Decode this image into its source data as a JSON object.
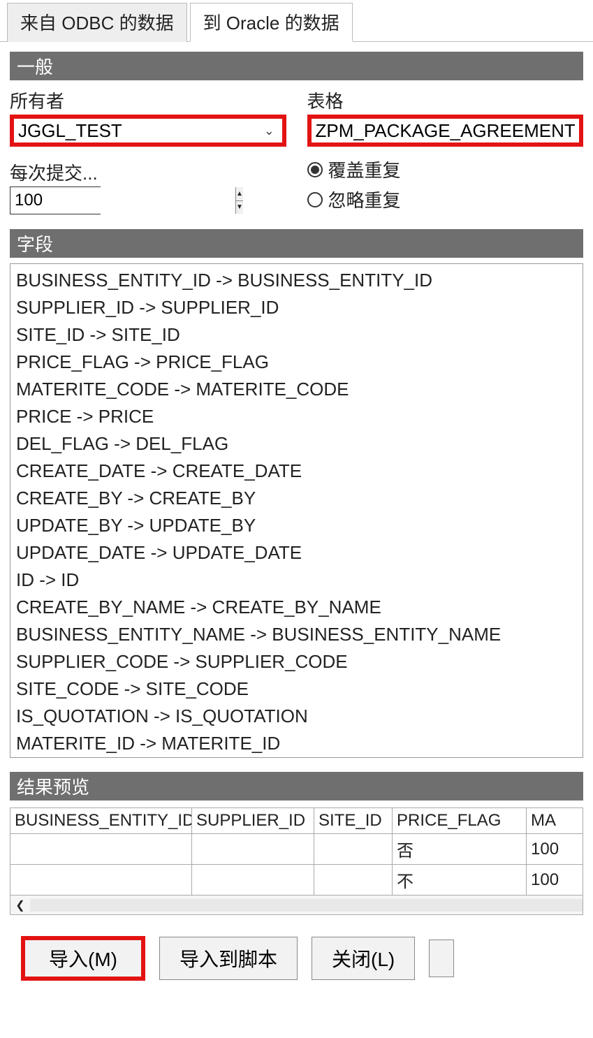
{
  "tabs": {
    "inactive": "来自 ODBC 的数据",
    "active": "到 Oracle 的数据"
  },
  "general": {
    "header": "一般",
    "owner_label": "所有者",
    "owner_value": "JGGL_TEST",
    "table_label": "表格",
    "table_value": "ZPM_PACKAGE_AGREEMENT",
    "commit_label": "每次提交...",
    "commit_value": "100",
    "radio_overwrite": "覆盖重复",
    "radio_ignore": "忽略重复"
  },
  "fields": {
    "header": "字段",
    "arrow": "->",
    "items": [
      {
        "src": "BUSINESS_ENTITY_ID",
        "dst": "BUSINESS_ENTITY_ID"
      },
      {
        "src": "SUPPLIER_ID",
        "dst": "SUPPLIER_ID"
      },
      {
        "src": "SITE_ID",
        "dst": "SITE_ID"
      },
      {
        "src": "PRICE_FLAG",
        "dst": "PRICE_FLAG"
      },
      {
        "src": "MATERITE_CODE",
        "dst": "MATERITE_CODE"
      },
      {
        "src": "PRICE",
        "dst": "PRICE"
      },
      {
        "src": "DEL_FLAG",
        "dst": "DEL_FLAG"
      },
      {
        "src": "CREATE_DATE",
        "dst": "CREATE_DATE"
      },
      {
        "src": "CREATE_BY",
        "dst": "CREATE_BY"
      },
      {
        "src": "UPDATE_BY",
        "dst": "UPDATE_BY"
      },
      {
        "src": "UPDATE_DATE",
        "dst": "UPDATE_DATE"
      },
      {
        "src": "ID",
        "dst": "ID"
      },
      {
        "src": "CREATE_BY_NAME",
        "dst": "CREATE_BY_NAME"
      },
      {
        "src": "BUSINESS_ENTITY_NAME",
        "dst": "BUSINESS_ENTITY_NAME"
      },
      {
        "src": "SUPPLIER_CODE",
        "dst": "SUPPLIER_CODE"
      },
      {
        "src": "SITE_CODE",
        "dst": "SITE_CODE"
      },
      {
        "src": "IS_QUOTATION",
        "dst": "IS_QUOTATION"
      },
      {
        "src": "MATERITE_ID",
        "dst": "MATERITE_ID"
      }
    ]
  },
  "preview": {
    "header": "结果预览",
    "columns": [
      "BUSINESS_ENTITY_ID",
      "SUPPLIER_ID",
      "SITE_ID",
      "PRICE_FLAG",
      "MA"
    ],
    "rows": [
      {
        "business": "",
        "supplier": "",
        "site": "",
        "price_flag": "否",
        "ma": "100"
      },
      {
        "business": "",
        "supplier": "",
        "site": "",
        "price_flag": "不",
        "ma": "100"
      }
    ]
  },
  "buttons": {
    "import": "导入(M)",
    "import_script": "导入到脚本",
    "close": "关闭(L)"
  }
}
